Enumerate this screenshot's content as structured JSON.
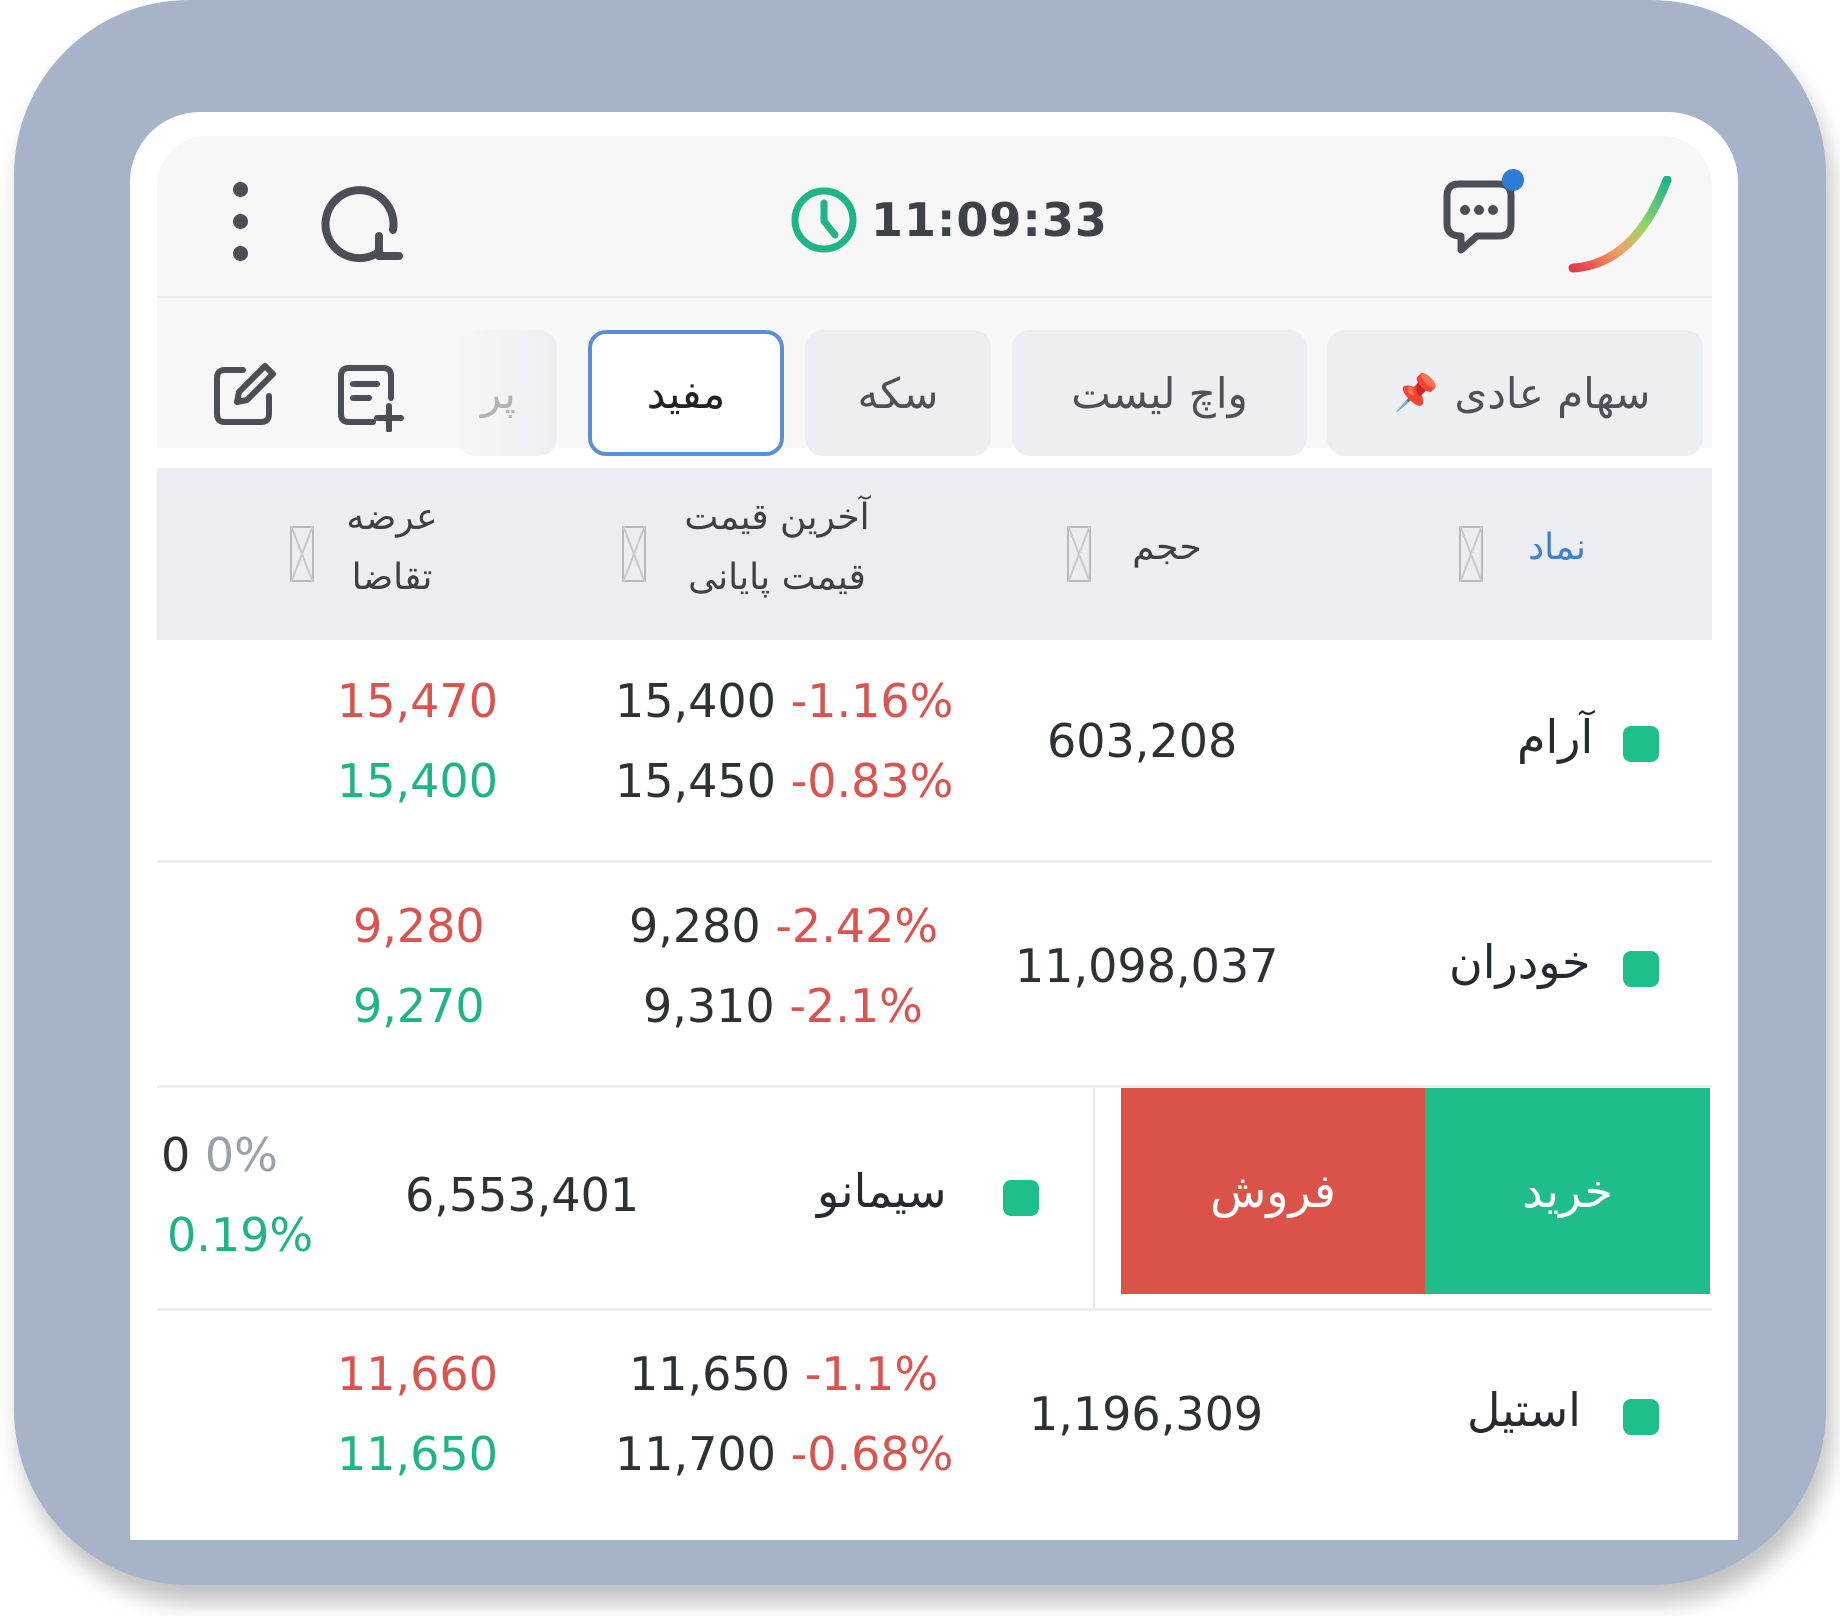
{
  "header": {
    "time": "11:09:33"
  },
  "tabs": [
    {
      "label": "سهام عادی"
    },
    {
      "label": "واچ لیست"
    },
    {
      "label": "سکه"
    },
    {
      "label": "مفید"
    },
    {
      "label": "پر"
    }
  ],
  "table": {
    "columns": {
      "symbol": "نماد",
      "volume": "حجم",
      "last_price": "آخرین قیمت",
      "close_price": "قیمت پایانی",
      "ask": "عرضه",
      "bid": "تقاضا"
    },
    "rows": [
      {
        "symbol": "آرام",
        "volume": "603,208",
        "last": "15,400",
        "last_pct": "-1.16%",
        "close": "15,450",
        "close_pct": "-0.83%",
        "ask": "15,470",
        "bid": "15,400"
      },
      {
        "symbol": "خودران",
        "volume": "11,098,037",
        "last": "9,280",
        "last_pct": "-2.42%",
        "close": "9,310",
        "close_pct": "-2.1%",
        "ask": "9,280",
        "bid": "9,270"
      },
      {
        "symbol": "سیمانو",
        "volume": "6,553,401",
        "last": "0",
        "last_pct": "0%",
        "close_pct": "0.19%",
        "buy_label": "خرید",
        "sell_label": "فروش"
      },
      {
        "symbol": "استیل",
        "volume": "1,196,309",
        "last": "11,650",
        "last_pct": "-1.1%",
        "close": "11,700",
        "close_pct": "-0.68%",
        "ask": "11,660",
        "bid": "11,650"
      }
    ]
  },
  "colors": {
    "accent": "#5b8fd4",
    "positive": "#1fb487",
    "negative": "#d9534f",
    "status_dot": "#1fbf8c"
  }
}
